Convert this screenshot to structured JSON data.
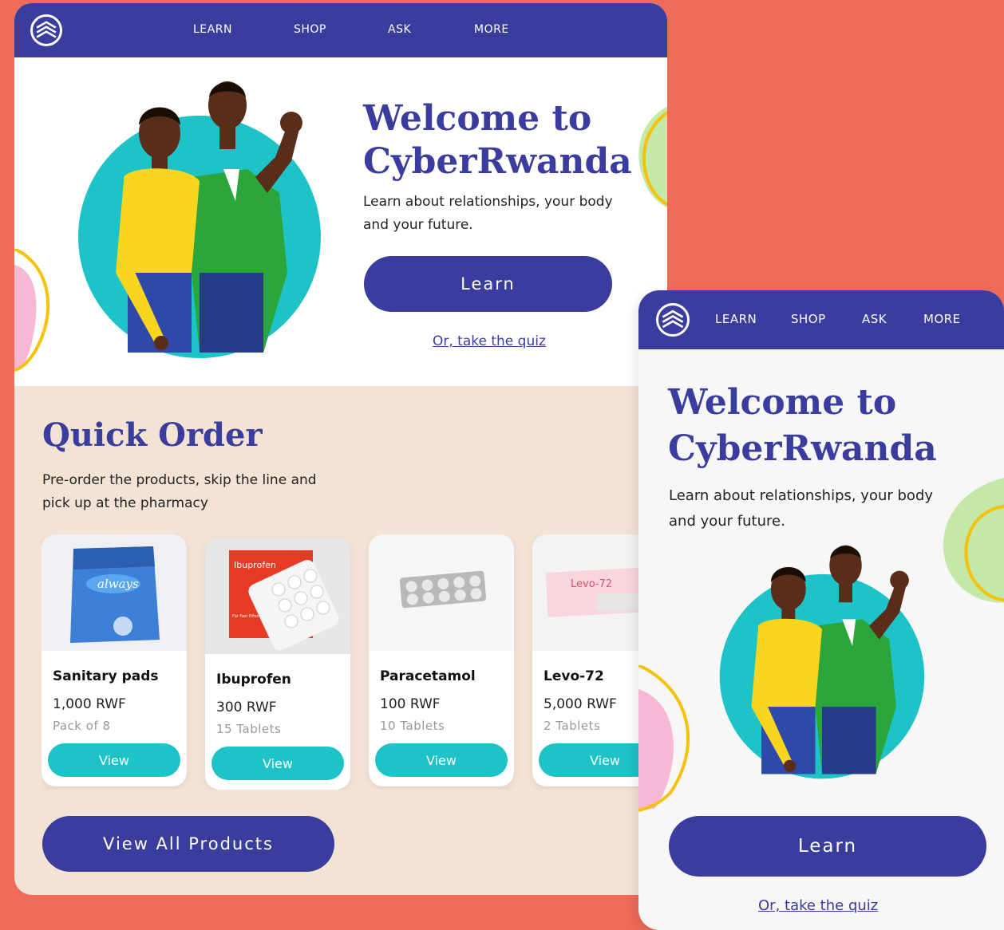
{
  "nav": {
    "items": [
      "LEARN",
      "SHOP",
      "ASK",
      "MORE"
    ]
  },
  "hero": {
    "title_line1": "Welcome to",
    "title_line2": "CyberRwanda",
    "text": "Learn about relationships, your body and your future.",
    "learn_button": "Learn",
    "quiz_link": "Or, take the quiz"
  },
  "quick_order": {
    "title": "Quick Order",
    "text": "Pre-order the products, skip the line and pick up at the pharmacy",
    "view_all_button": "View All Products",
    "products": [
      {
        "name": "Sanitary pads",
        "price": "1,000 RWF",
        "qty": "Pack of 8",
        "button": "View",
        "pack_brand": "always"
      },
      {
        "name": "Ibuprofen",
        "price": "300 RWF",
        "qty": "15 Tablets",
        "button": "View",
        "pack_brand": "Ibuprofen",
        "pack_tag": "For Fast Effective Pain Relief"
      },
      {
        "name": "Paracetamol",
        "price": "100 RWF",
        "qty": "10 Tablets",
        "button": "View"
      },
      {
        "name": "Levo-72",
        "price": "5,000 RWF",
        "qty": "2 Tablets",
        "button": "View",
        "pack_brand": "Levo-72"
      }
    ]
  },
  "mobile": {
    "nav_items": [
      "LEARN",
      "SHOP",
      "ASK",
      "MORE"
    ],
    "title_line1": "Welcome to",
    "title_line2": "CyberRwanda",
    "text": "Learn about relationships, your body and your future.",
    "learn_button": "Learn",
    "quiz_link": "Or, take the quiz"
  },
  "colors": {
    "background": "#ef6b5a",
    "brand": "#3a3c9e",
    "accent": "#1dc3c7",
    "cream": "#f3e3d5"
  }
}
